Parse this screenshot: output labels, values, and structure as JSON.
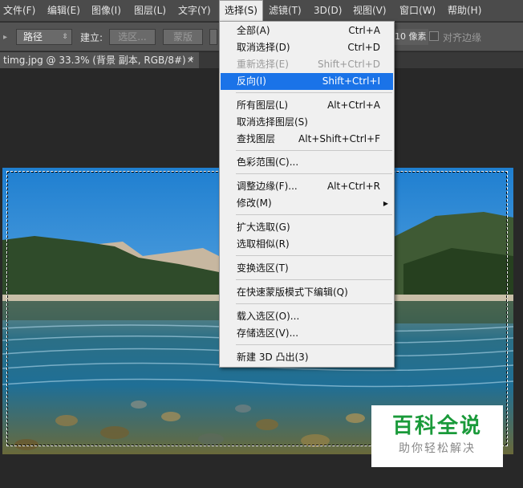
{
  "menubar": {
    "items": [
      {
        "label": "文件(F)"
      },
      {
        "label": "编辑(E)"
      },
      {
        "label": "图像(I)"
      },
      {
        "label": "图层(L)"
      },
      {
        "label": "文字(Y)"
      },
      {
        "label": "选择(S)"
      },
      {
        "label": "滤镜(T)"
      },
      {
        "label": "3D(D)"
      },
      {
        "label": "视图(V)"
      },
      {
        "label": "窗口(W)"
      },
      {
        "label": "帮助(H)"
      }
    ]
  },
  "options": {
    "path_select": "路径",
    "make_label": "建立:",
    "selection_btn": "选区...",
    "mask_btn": "蒙版",
    "px_value": "10 像素",
    "align_edges_label": "对齐边缘"
  },
  "tab": {
    "title": "timg.jpg @ 33.3% (背景 副本, RGB/8#) *",
    "close": "×"
  },
  "select_menu": {
    "items": [
      {
        "label": "全部(A)",
        "shortcut": "Ctrl+A",
        "disabled": false
      },
      {
        "label": "取消选择(D)",
        "shortcut": "Ctrl+D",
        "disabled": false
      },
      {
        "label": "重新选择(E)",
        "shortcut": "Shift+Ctrl+D",
        "disabled": true
      },
      {
        "label": "反向(I)",
        "shortcut": "Shift+Ctrl+I",
        "disabled": false,
        "highlighted": true
      },
      {
        "label": "所有图层(L)",
        "shortcut": "Alt+Ctrl+A",
        "disabled": false
      },
      {
        "label": "取消选择图层(S)",
        "shortcut": "",
        "disabled": false
      },
      {
        "label": "查找图层",
        "shortcut": "Alt+Shift+Ctrl+F",
        "disabled": false
      },
      {
        "label": "色彩范围(C)...",
        "shortcut": "",
        "disabled": false
      },
      {
        "label": "调整边缘(F)...",
        "shortcut": "Alt+Ctrl+R",
        "disabled": false
      },
      {
        "label": "修改(M)",
        "shortcut": "",
        "disabled": false,
        "submenu": true
      },
      {
        "label": "扩大选取(G)",
        "shortcut": "",
        "disabled": false
      },
      {
        "label": "选取相似(R)",
        "shortcut": "",
        "disabled": false
      },
      {
        "label": "变换选区(T)",
        "shortcut": "",
        "disabled": false
      },
      {
        "label": "在快速蒙版模式下编辑(Q)",
        "shortcut": "",
        "disabled": false
      },
      {
        "label": "载入选区(O)...",
        "shortcut": "",
        "disabled": false
      },
      {
        "label": "存储选区(V)...",
        "shortcut": "",
        "disabled": false
      },
      {
        "label": "新建 3D 凸出(3)",
        "shortcut": "",
        "disabled": false
      }
    ]
  },
  "watermark": {
    "title": "百科全说",
    "subtitle": "助你轻松解决"
  },
  "colors": {
    "menu_highlight": "#1a73e8",
    "watermark_green": "#1a9a3a"
  }
}
